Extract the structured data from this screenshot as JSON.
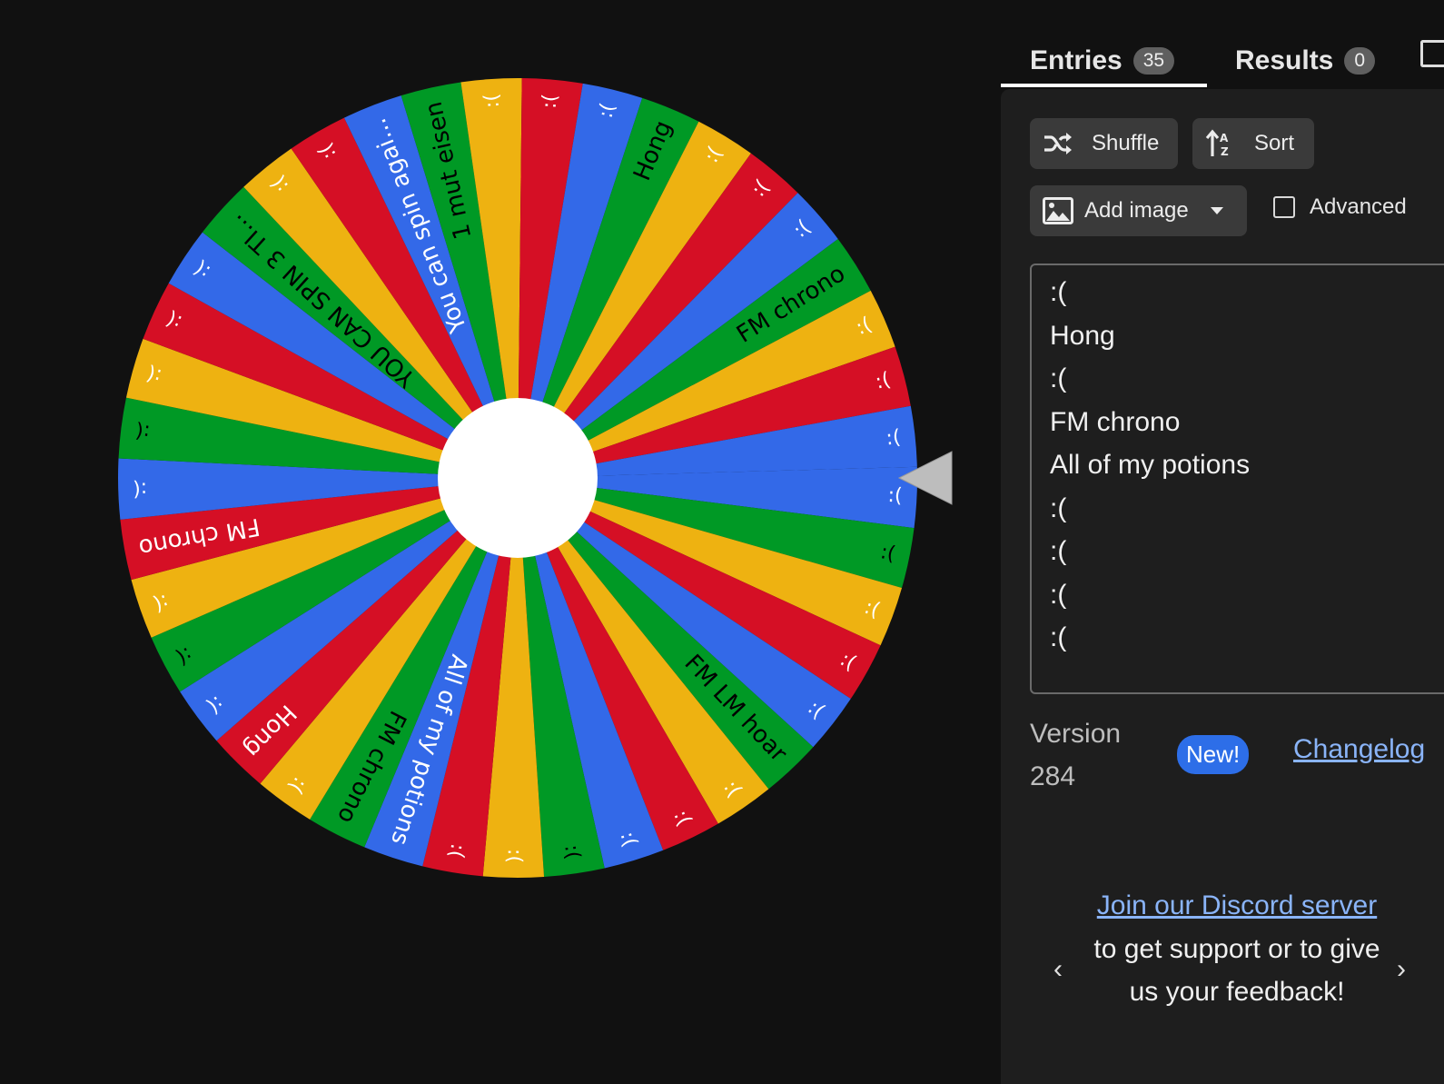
{
  "wheel": {
    "colors": [
      "#3369e8",
      "#009925",
      "#eeb211",
      "#d50f25"
    ],
    "segments": [
      ":(",
      ":(",
      ":(",
      ":(",
      ":(",
      "FM LM hoar",
      ":(",
      ":(",
      ":(",
      ":(",
      ":(",
      ":(",
      "All of my potions",
      "FM chrono",
      ":(",
      "Hong",
      ":(",
      ":(",
      ":(",
      "FM chrono",
      ":(",
      ":(",
      ":(",
      ":(",
      ":(",
      "YOU CAN SPIN 3 TI...",
      ":(",
      ":(",
      "You can spin agai...",
      "1 mut eisen",
      ":(",
      ":(",
      ":(",
      "Hong",
      ":(",
      ":(",
      ":(",
      "FM chrono",
      ":(",
      ":(",
      ":("
    ],
    "center_color": "#ffffff"
  },
  "tabs": {
    "entries_label": "Entries",
    "entries_count": "35",
    "results_label": "Results",
    "results_count": "0"
  },
  "toolbar": {
    "shuffle_label": "Shuffle",
    "sort_label": "Sort",
    "add_image_label": "Add image",
    "advanced_label": "Advanced"
  },
  "entries": [
    ":(",
    "Hong",
    ":(",
    "FM chrono",
    "All of my potions",
    ":(",
    ":(",
    ":(",
    ":("
  ],
  "version": {
    "label": "Version",
    "number": "284",
    "new_badge": "New!",
    "changelog_label": "Changelog"
  },
  "promo": {
    "link_text": "Join our Discord server",
    "rest_text": "to get support or to give us your feedback!",
    "prev": "‹",
    "next": "›"
  }
}
